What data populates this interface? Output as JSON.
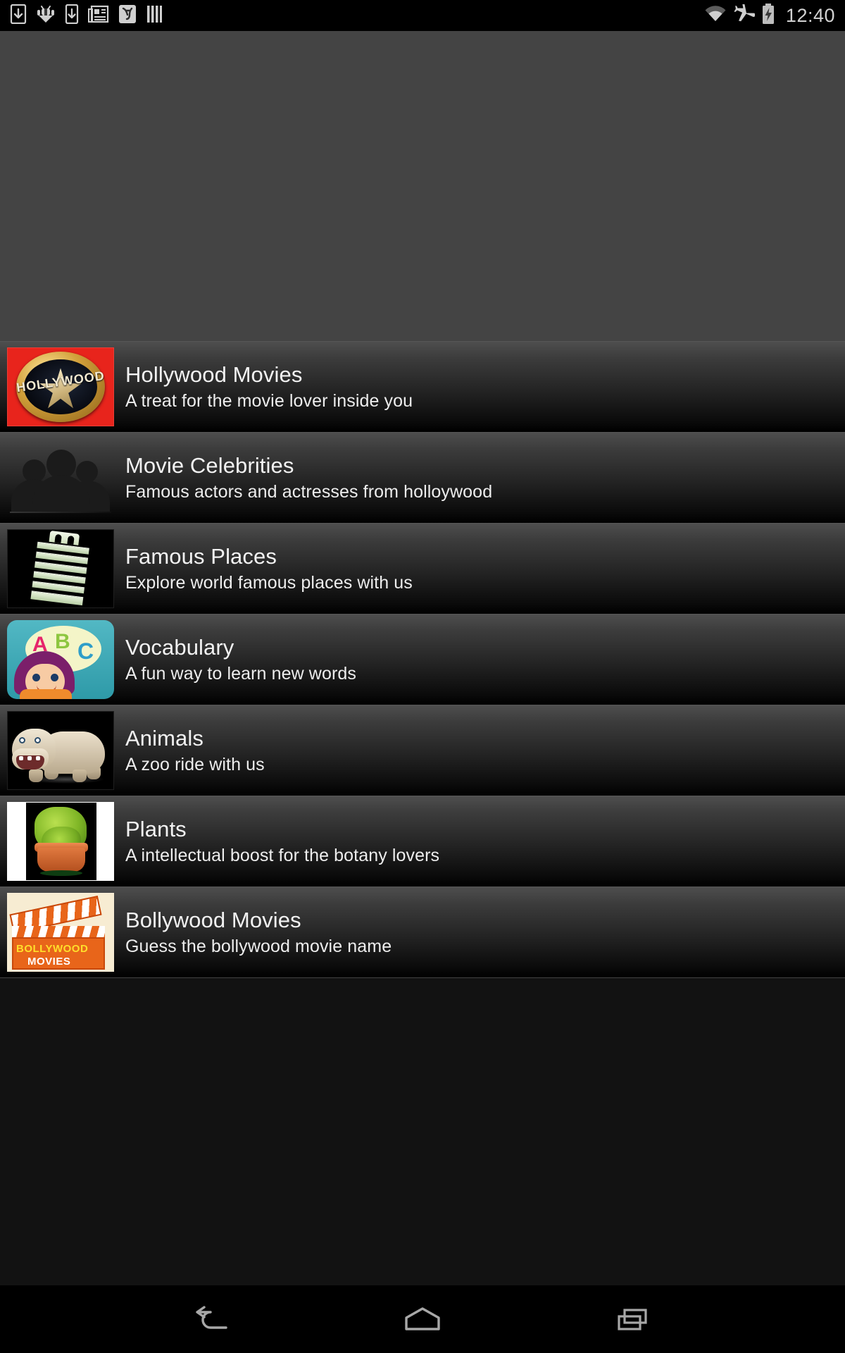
{
  "statusbar": {
    "time": "12:40",
    "left_icons": [
      {
        "name": "download-icon",
        "label": "download"
      },
      {
        "name": "android-debug-icon",
        "label": "android debug bridge"
      },
      {
        "name": "download-phone-icon",
        "label": "download to device"
      },
      {
        "name": "news-icon",
        "label": "news"
      },
      {
        "name": "app-f-icon",
        "label": "app notification"
      },
      {
        "name": "bars-icon",
        "label": "bars"
      }
    ],
    "right_icons": [
      {
        "name": "wifi-icon",
        "label": "wifi"
      },
      {
        "name": "airplane-mode-icon",
        "label": "airplane mode"
      },
      {
        "name": "battery-charging-icon",
        "label": "battery charging"
      }
    ]
  },
  "list": {
    "items": [
      {
        "title": "Hollywood Movies",
        "subtitle": "A treat for the movie lover inside you",
        "thumb": "hollywood-thumb",
        "thumb_text": "HOLLYWOOD",
        "accent": "#e8241c"
      },
      {
        "title": "Movie Celebrities",
        "subtitle": "Famous actors and actresses from holloywood",
        "thumb": "celebrities-thumb",
        "accent": "#1b1b1b"
      },
      {
        "title": "Famous Places",
        "subtitle": "Explore world famous places with us",
        "thumb": "famous-places-thumb",
        "accent": "#cfe0bd"
      },
      {
        "title": "Vocabulary",
        "subtitle": "A fun way to learn new words",
        "thumb": "vocabulary-thumb",
        "thumb_letters": [
          "A",
          "B",
          "C"
        ],
        "accent": "#52b8c4"
      },
      {
        "title": "Animals",
        "subtitle": "A zoo ride with us",
        "thumb": "animals-thumb",
        "accent": "#c3b396"
      },
      {
        "title": "Plants",
        "subtitle": "A intellectual boost for the botany lovers",
        "thumb": "plants-thumb",
        "accent": "#7fb626"
      },
      {
        "title": "Bollywood Movies",
        "subtitle": "Guess the bollywood movie name",
        "thumb": "bollywood-thumb",
        "thumb_line1": "BOLLYWOOD",
        "thumb_line2": "MOVIES",
        "accent": "#e8651a"
      }
    ]
  },
  "navbar": {
    "buttons": [
      {
        "name": "back-button",
        "label": "Back"
      },
      {
        "name": "home-button",
        "label": "Home"
      },
      {
        "name": "recents-button",
        "label": "Recent apps"
      }
    ]
  },
  "colors": {
    "background": "#444444",
    "row_top": "#4e4e4e",
    "row_bottom": "#000000",
    "title_text": "#f2f2f2",
    "subtitle_text": "#ededed",
    "statusbar_bg": "#000000",
    "clock_text": "#d2d2d2"
  }
}
